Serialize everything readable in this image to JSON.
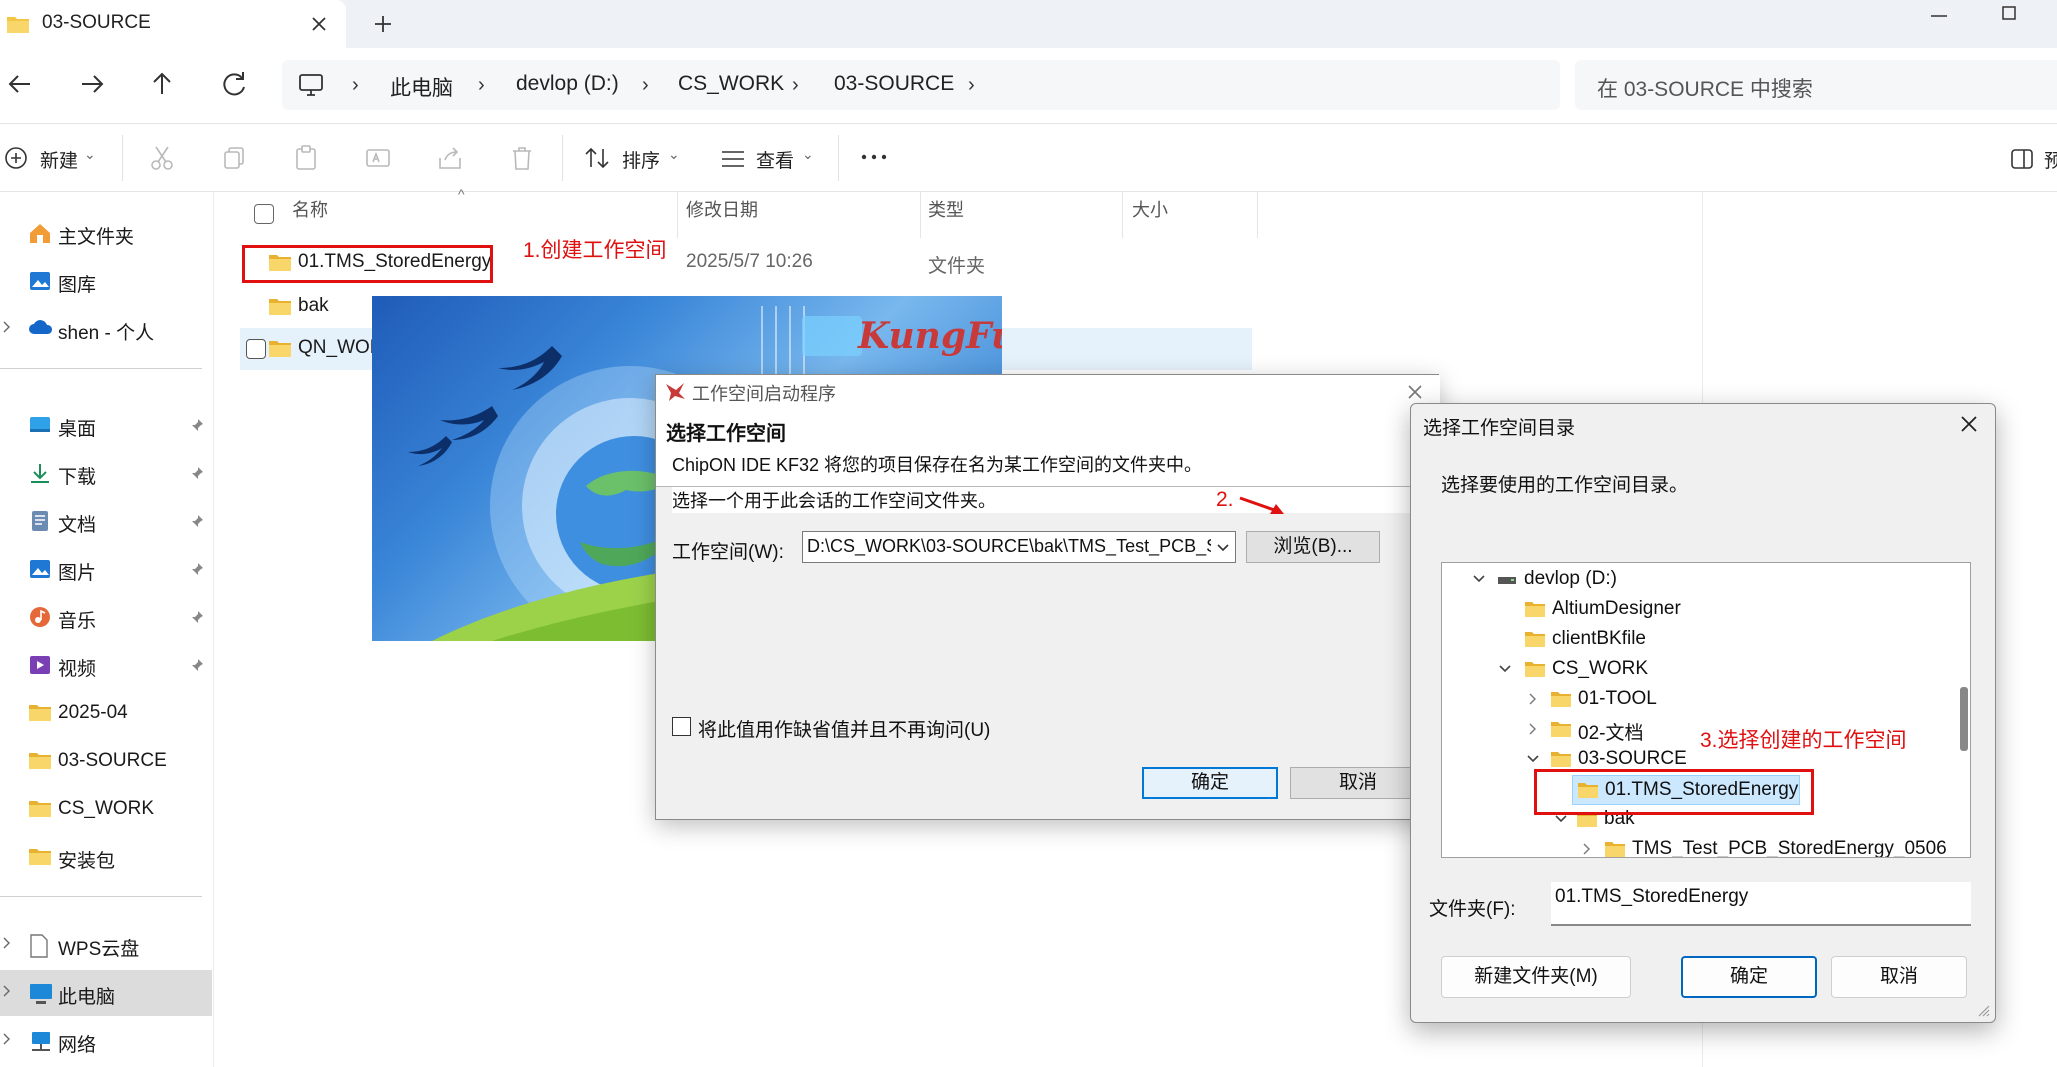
{
  "tab": {
    "title": "03-SOURCE"
  },
  "breadcrumb": [
    "此电脑",
    "devlop (D:)",
    "CS_WORK",
    "03-SOURCE"
  ],
  "search": {
    "placeholder": "在 03-SOURCE 中搜索"
  },
  "toolbar": {
    "new_label": "新建",
    "sort_label": "排序",
    "view_label": "查看",
    "preview_label": "预"
  },
  "sidebar": {
    "quick": [
      "主文件夹",
      "图库",
      "shen - 个人"
    ],
    "pinned": [
      "桌面",
      "下载",
      "文档",
      "图片",
      "音乐",
      "视频"
    ],
    "folders": [
      "2025-04",
      "03-SOURCE",
      "CS_WORK",
      "安装包"
    ],
    "locations": [
      "WPS云盘",
      "此电脑",
      "网络"
    ]
  },
  "columns": {
    "name": "名称",
    "date": "修改日期",
    "type": "类型",
    "size": "大小"
  },
  "files": [
    {
      "name": "01.TMS_StoredEnergy",
      "date": "2025/5/7 10:26",
      "type": "文件夹"
    },
    {
      "name": "bak",
      "date": "",
      "type": ""
    },
    {
      "name": "QN_WOR",
      "date": "",
      "type": ""
    }
  ],
  "annotations": {
    "step1": "1.创建工作空间",
    "step2": "2.",
    "step3": "3.选择创建的工作空间"
  },
  "splash": {
    "logo": "KungFu"
  },
  "launcher": {
    "title": "工作空间启动程序",
    "heading": "选择工作空间",
    "desc1": "ChipON IDE KF32 将您的项目保存在名为某工作空间的文件夹中。",
    "desc2": "选择一个用于此会话的工作空间文件夹。",
    "workspace_label": "工作空间(W):",
    "workspace_value": "D:\\CS_WORK\\03-SOURCE\\bak\\TMS_Test_PCB_S",
    "browse": "浏览(B)...",
    "default_check": "将此值用作缺省值并且不再询问(U)",
    "ok": "确定",
    "cancel": "取消"
  },
  "picker": {
    "title": "选择工作空间目录",
    "prompt": "选择要使用的工作空间目录。",
    "tree": [
      "devlop (D:)",
      "AltiumDesigner",
      "clientBKfile",
      "CS_WORK",
      "01-TOOL",
      "02-文档",
      "03-SOURCE",
      "01.TMS_StoredEnergy",
      "bak",
      "TMS_Test_PCB_StoredEnergy_0506"
    ],
    "folder_label": "文件夹(F):",
    "folder_value": "01.TMS_StoredEnergy",
    "new_folder": "新建文件夹(M)",
    "ok": "确定",
    "cancel": "取消"
  },
  "colors": {
    "accent": "#0078d7",
    "annotation": "#e01010",
    "folder": "#f3c544"
  }
}
